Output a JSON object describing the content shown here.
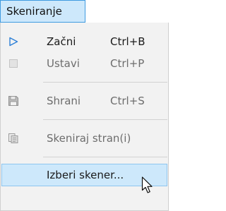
{
  "menubar": {
    "title": "Skeniranje"
  },
  "menu": {
    "items": [
      {
        "icon": "play-icon",
        "label": "Začni",
        "shortcut": "Ctrl+B",
        "enabled": true
      },
      {
        "icon": "stop-icon",
        "label": "Ustavi",
        "shortcut": "Ctrl+P",
        "enabled": false
      },
      {
        "icon": "save-icon",
        "label": "Shrani",
        "shortcut": "Ctrl+S",
        "enabled": false
      },
      {
        "icon": "scan-page-icon",
        "label": "Skeniraj stran(i)",
        "shortcut": "",
        "enabled": false
      },
      {
        "icon": "",
        "label": "Izberi skener...",
        "shortcut": "",
        "enabled": true,
        "highlighted": true
      }
    ]
  },
  "colors": {
    "highlight": "#cde8fb",
    "highlight_border": "#3f9be0",
    "play_accent": "#2c7fd6",
    "disabled_text": "#6d6d6d"
  }
}
